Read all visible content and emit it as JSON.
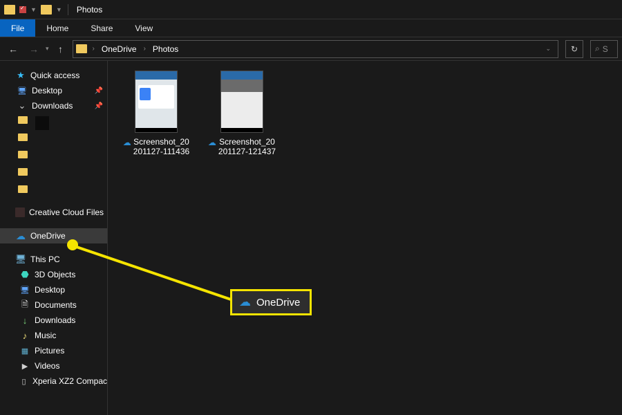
{
  "window": {
    "title": "Photos"
  },
  "ribbon": {
    "file": "File",
    "tabs": [
      "Home",
      "Share",
      "View"
    ]
  },
  "address": {
    "crumbs": [
      "OneDrive",
      "Photos"
    ]
  },
  "search": {
    "placeholder": "S"
  },
  "sidebar": {
    "quick_access": {
      "label": "Quick access"
    },
    "desktop": {
      "label": "Desktop"
    },
    "downloads": {
      "label": "Downloads"
    },
    "creative_cloud": {
      "label": "Creative Cloud Files"
    },
    "onedrive": {
      "label": "OneDrive"
    },
    "this_pc": {
      "label": "This PC"
    },
    "pc_children": {
      "objects3d": "3D Objects",
      "desktop": "Desktop",
      "documents": "Documents",
      "downloads": "Downloads",
      "music": "Music",
      "pictures": "Pictures",
      "videos": "Videos",
      "phone": "Xperia XZ2 Compac"
    }
  },
  "files": [
    {
      "name_l1": "Screenshot_20",
      "name_l2": "201127-111436"
    },
    {
      "name_l1": "Screenshot_20",
      "name_l2": "201127-121437"
    }
  ],
  "callout": {
    "label": "OneDrive"
  }
}
